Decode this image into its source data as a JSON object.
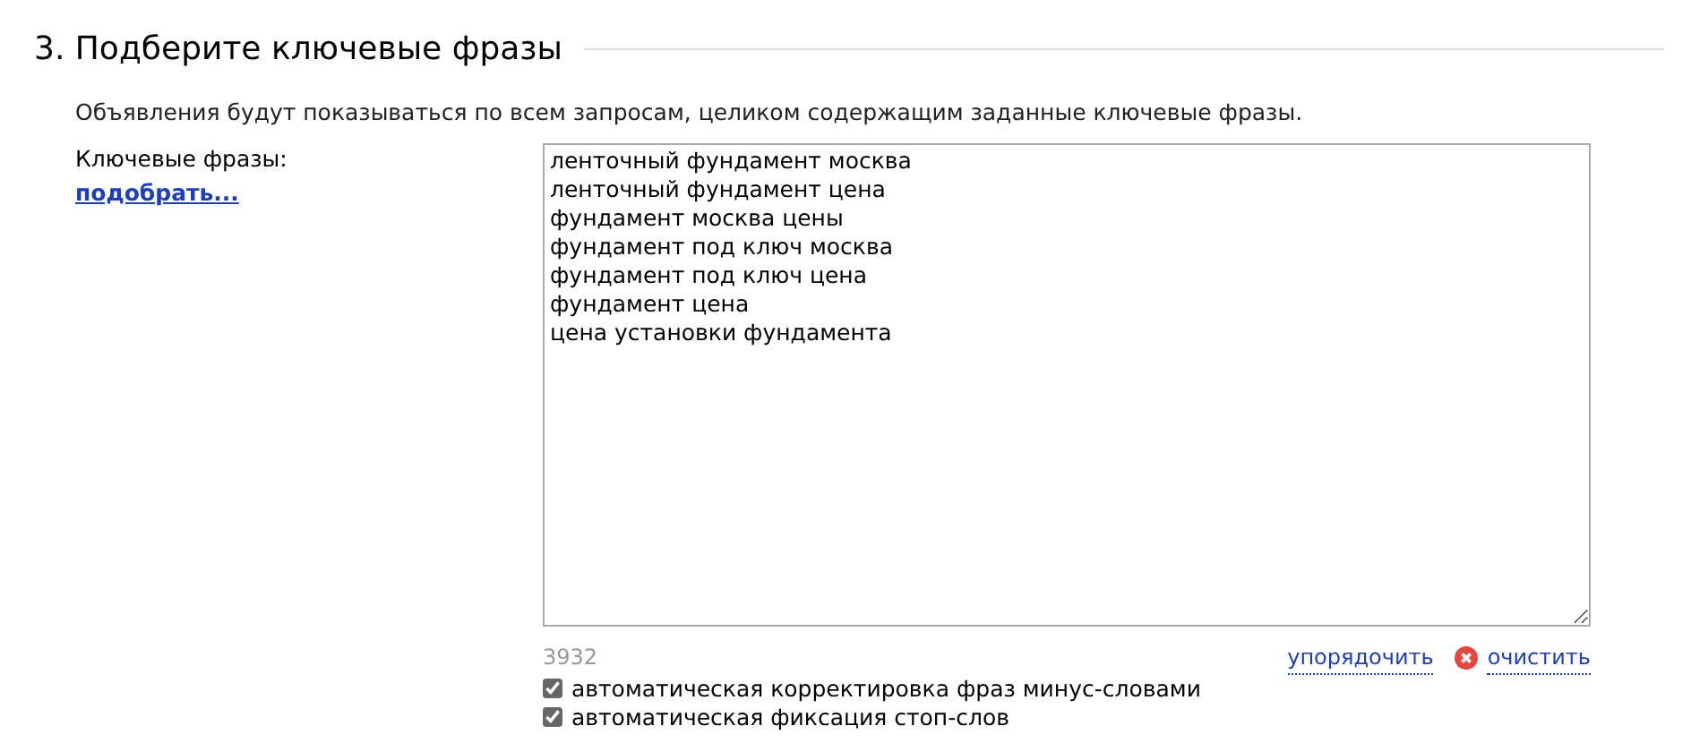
{
  "section": {
    "title": "3. Подберите ключевые фразы",
    "description": "Объявления будут показываться по всем запросам, целиком содержащим заданные ключевые фразы."
  },
  "keywords": {
    "label": "Ключевые фразы:",
    "pick_link": "подобрать...",
    "phrases": [
      "ленточный фундамент москва",
      "ленточный фундамент цена",
      "фундамент москва цены",
      "фундамент под ключ москва",
      "фундамент под ключ цена",
      "фундамент цена",
      "цена установки фундамента"
    ],
    "counter": "3932",
    "sort_link": "упорядочить",
    "clear_link": "очистить"
  },
  "options": [
    {
      "label": "автоматическая корректировка фраз минус-словами",
      "checked": true
    },
    {
      "label": "автоматическая фиксация стоп-слов",
      "checked": true
    }
  ]
}
